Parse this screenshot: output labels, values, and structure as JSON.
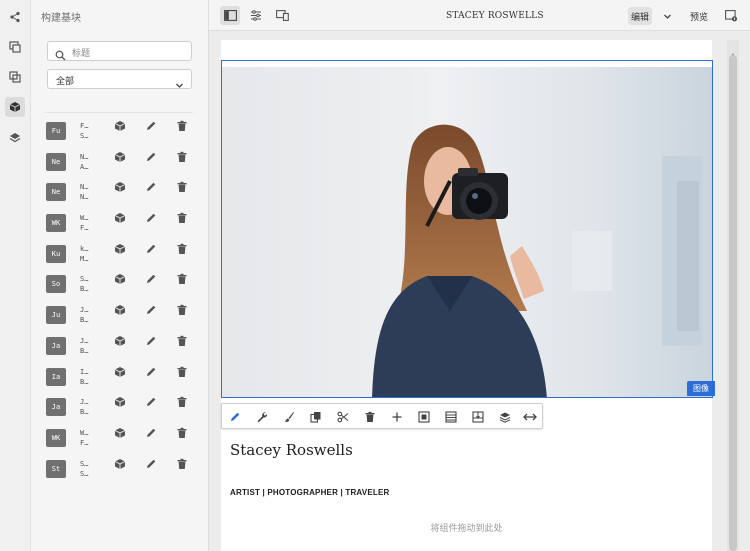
{
  "panel": {
    "title": "构建基块",
    "search_placeholder": "标题",
    "filter_value": "全部"
  },
  "rows": [
    {
      "abbr": "Fu",
      "line1": "F…",
      "line2": "S…"
    },
    {
      "abbr": "Ne",
      "line1": "N…",
      "line2": "A…"
    },
    {
      "abbr": "Ne",
      "line1": "N…",
      "line2": "N…"
    },
    {
      "abbr": "WK",
      "line1": "W…",
      "line2": "F…"
    },
    {
      "abbr": "Ku",
      "line1": "k…",
      "line2": "M…"
    },
    {
      "abbr": "So",
      "line1": "S…",
      "line2": "B…"
    },
    {
      "abbr": "Ju",
      "line1": "J…",
      "line2": "B…"
    },
    {
      "abbr": "Ja",
      "line1": "J…",
      "line2": "B…"
    },
    {
      "abbr": "Ia",
      "line1": "I…",
      "line2": "B…"
    },
    {
      "abbr": "Ja",
      "line1": "J…",
      "line2": "B…"
    },
    {
      "abbr": "WK",
      "line1": "W…",
      "line2": "F…"
    },
    {
      "abbr": "St",
      "line1": "S…",
      "line2": "S…"
    }
  ],
  "topbar": {
    "title": "STACEY ROSWELLS",
    "edit_label": "编辑",
    "preview_label": "预览"
  },
  "page": {
    "image_badge": "图像",
    "name": "Stacey Roswells",
    "tagline": "ARTIST | PHOTOGRAPHER | TRAVELER",
    "drop_hint": "将组件拖动到此处"
  },
  "icons": {
    "rail": [
      "share-icon",
      "assets-icon",
      "components-icon",
      "blocks-icon",
      "layers-icon"
    ],
    "component_toolbar": [
      "pencil-icon",
      "wrench-icon",
      "brush-icon",
      "copy-icon",
      "cut-icon",
      "trash-icon",
      "plus-icon",
      "crop-icon",
      "list-icon",
      "group-icon",
      "stack-icon",
      "resize-icon"
    ]
  },
  "colors": {
    "accent": "#2c6ed5",
    "abbr_bg": "#707070"
  }
}
